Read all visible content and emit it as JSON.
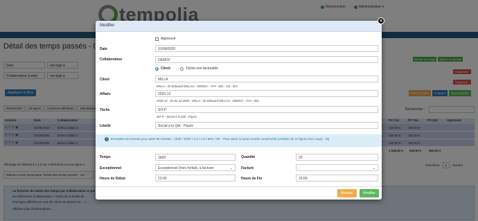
{
  "app": {
    "logo_text": "tempolia",
    "disconnect_label": "Déconnexion",
    "user_label": "Administrateur ▾"
  },
  "page": {
    "title": "Détail des temps passés - 01/"
  },
  "filters": {
    "field1": "Date",
    "op1": "est égal à",
    "field2": "Collaborateur (code)",
    "op2": "est égal à",
    "apply_label": "Appliquer le filtre"
  },
  "toolbar": {
    "tabs": [
      "Rechercher",
      "20 lignes",
      "Colonnes affichées",
      "Réinitialiser (col..."
    ],
    "add_rule_label": "Ajouter une règle",
    "add_group_label": "Ajouter un groupe",
    "delete_label": "Supprimer",
    "btn_filter": "Filtre de filtre",
    "btn_load": "Charger",
    "btn_save": "Sauvegarder",
    "search_label": "Rechercher :"
  },
  "table": {
    "columns": [
      "Actions",
      "Date",
      "Collaborateur",
      "Client",
      "PV Col.",
      "PV Tax.",
      "PV Qté",
      "Approuvé"
    ],
    "rows": [
      [
        "",
        "01/09/2020",
        "Demo collab 2",
        "",
        "420,00 €",
        "150,00 €",
        "",
        ""
      ],
      [
        "",
        "01/09/2020",
        "Demo collab 3",
        "",
        "420,00 €",
        "150,00 €",
        "",
        ""
      ],
      [
        "",
        "01/09/2020",
        "Demo collab 3",
        "",
        "420,00 €",
        "150,00 €",
        "",
        ""
      ]
    ],
    "totals": [
      "1 540,00 €",
      "630,00 €",
      "550,00 €"
    ],
    "info": "Affichage de l'élément 1 à 3 sur 3 éléments   Aucune ligne s...",
    "pager": {
      "prev": "Précédent",
      "current": "1",
      "next": "Suivant"
    }
  },
  "bg_summary": "Tableau croisé dynamique \"Détail des temps passés - 01/...\"",
  "help": {
    "title": "La fonction de saisie des temps par collaborateur et par ...",
    "line1": "les références (collaborateur + mois) de la feuille de ...",
    "line2": "Une ligne affichée en rose (le client est absent ou ... ) ...",
    "line3": "Affichez plus d'informations..."
  },
  "modal": {
    "title": "Modifier",
    "approved_label": "Approuvé",
    "date_label": "Date",
    "date_value": "01/09/2020",
    "collab_label": "Collaborateur",
    "collab_value": "DEMO2",
    "radio_client": "Client",
    "radio_nonfact": "Tâche non facturable",
    "client_label": "Client",
    "client_value": "MILLA",
    "client_hint": "MILLA : Dr Edouard MILLAU - DEMO2 - JYH - 001 - G8 - DIV",
    "affaire_label": "Affaire",
    "affaire_value": "2020-12",
    "affaire_hint": "2020-12 - Ex 01.12.2020 - MILLA : Dr Edouard MILLAU - DEMO2 - JYH - 001",
    "tache_label": "Tâche",
    "tache_value": "SO-P",
    "tache_hint": "SO-P - Social à la Qté - Payes",
    "libelle_label": "Libellé",
    "libelle_value": "Social à la Qté - Payes",
    "info_text": "Exemples de formats pour saisir 90 minutes : 1h30 / 1h30' / 1,5 / 1.5 / 90m / 90' - Pour saisir 10 jours ouvrés consécutifs (création de 10 lignes d'un coup) : 10j",
    "temps_label": "Temps",
    "temps_value": "3h00",
    "quantite_label": "Quantité",
    "quantite_value": "20",
    "exceptionnel_label": "Exceptionnel",
    "exceptionnel_value": "Exceptionnel (hors forfait), à facturer",
    "facture_label": "Facturé",
    "facture_value": "-",
    "heure_debut_label": "Heure de Début",
    "heure_debut_value": "13:00",
    "heure_fin_label": "Heure de Fin",
    "heure_fin_value": "16:00",
    "cancel_label": "Annuler",
    "save_label": "Modifier"
  },
  "colors": {
    "nav": "#1f5d7e",
    "primary": "#337ab7",
    "success": "#5cb85c",
    "warning": "#f0ad4e",
    "danger": "#d9534f",
    "modal_header": "#dfe9f6",
    "info_bg": "#d9edf7"
  }
}
